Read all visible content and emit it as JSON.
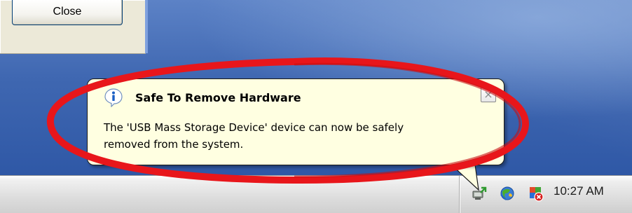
{
  "window": {
    "close_button_label": "Close"
  },
  "balloon": {
    "title": "Safe To Remove Hardware",
    "message_line1": "The 'USB Mass Storage Device' device can now be safely",
    "message_line2": "removed from the system.",
    "close_glyph": "×",
    "info_icon": "info-icon",
    "background_color": "#ffffe1"
  },
  "tray": {
    "icons": [
      "safely-remove-hardware-icon",
      "network-icon",
      "security-alert-icon"
    ],
    "clock": "10:27 AM"
  },
  "annotation": {
    "color": "#e8161b"
  }
}
